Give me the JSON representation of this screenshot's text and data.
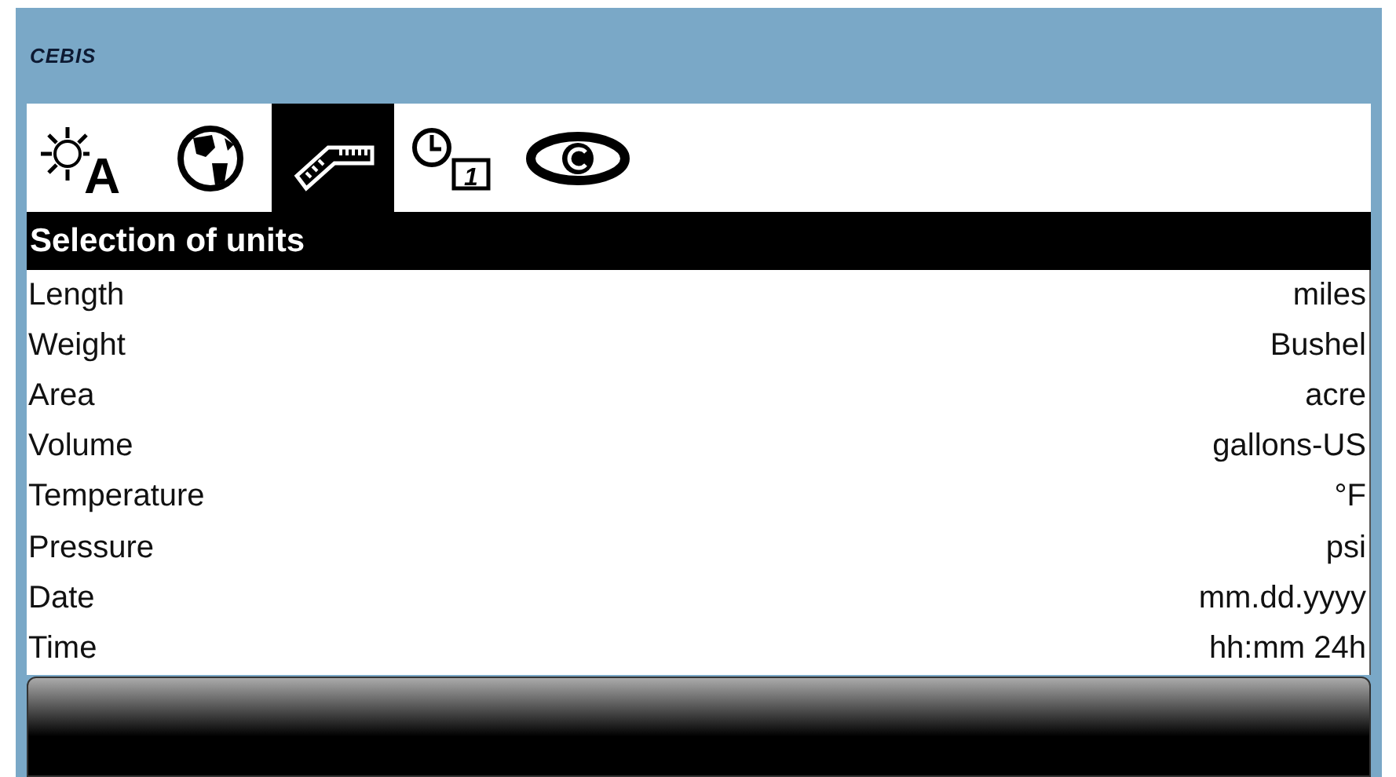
{
  "header": {
    "title": "CEBIS"
  },
  "tabs": [
    {
      "kind": "brightness",
      "glyph": "A",
      "selected": false
    },
    {
      "kind": "globe",
      "selected": false
    },
    {
      "kind": "ruler",
      "selected": true
    },
    {
      "kind": "clock-calendar",
      "glyph": "1",
      "selected": false
    },
    {
      "kind": "eye",
      "selected": false
    }
  ],
  "section": {
    "title": "Selection of units"
  },
  "rows": [
    {
      "label": "Length",
      "value": "miles"
    },
    {
      "label": "Weight",
      "value": "Bushel"
    },
    {
      "label": "Area",
      "value": "acre"
    },
    {
      "label": "Volume",
      "value": "gallons-US"
    },
    {
      "label": "Temperature",
      "value": "°F"
    },
    {
      "label": "Pressure",
      "value": "psi"
    },
    {
      "label": "Date",
      "value": "mm.dd.yyyy"
    },
    {
      "label": "Time",
      "value": "hh:mm 24h"
    }
  ]
}
